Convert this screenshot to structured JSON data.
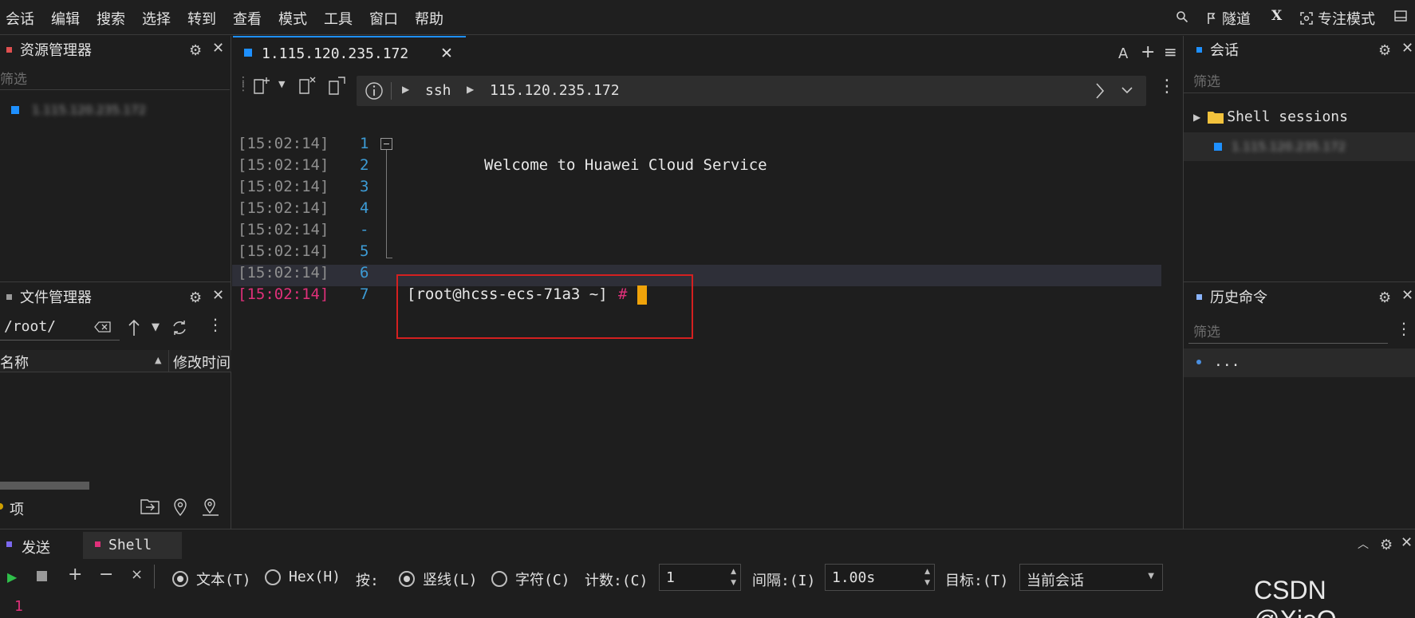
{
  "menu": [
    "会话",
    "编辑",
    "搜索",
    "选择",
    "转到",
    "查看",
    "模式",
    "工具",
    "窗口",
    "帮助"
  ],
  "menu_right": {
    "tunnel": "隧道",
    "x": "X",
    "focus": "专注模式"
  },
  "resource_panel": {
    "title": "资源管理器",
    "filter_placeholder": "筛选",
    "item": "1.115.120.235.172"
  },
  "file_panel": {
    "title": "文件管理器",
    "path": "/root/",
    "col_name": "名称",
    "col_time": "修改时间",
    "footer": "项"
  },
  "tab": {
    "title": "1.115.120.235.172"
  },
  "tab_right": {
    "font": "A",
    "add": "+",
    "menu": "≡"
  },
  "address": {
    "protocol": "ssh",
    "host": "115.120.235.172"
  },
  "terminal": {
    "lines": [
      {
        "ts": "[15:02:14]",
        "num": "1",
        "text": ""
      },
      {
        "ts": "[15:02:14]",
        "num": "2",
        "text": "Welcome to Huawei Cloud Service"
      },
      {
        "ts": "[15:02:14]",
        "num": "3",
        "text": ""
      },
      {
        "ts": "[15:02:14]",
        "num": "4",
        "text": ""
      },
      {
        "ts": "[15:02:14]",
        "num": "-",
        "text": ""
      },
      {
        "ts": "[15:02:14]",
        "num": "5",
        "text": ""
      },
      {
        "ts": "[15:02:14]",
        "num": "6",
        "text": ""
      },
      {
        "ts": "[15:02:14]",
        "num": "7",
        "text": "[root@hcss-ecs-71a3 ~]",
        "prompt_symbol": "#"
      }
    ]
  },
  "sessions_panel": {
    "title": "会话",
    "filter_placeholder": "筛选",
    "folder": "Shell sessions",
    "item": "1.115.120.235.172"
  },
  "history_panel": {
    "title": "历史命令",
    "filter_placeholder": "筛选",
    "item": "..."
  },
  "bottom": {
    "tab_send": "发送",
    "tab_shell": "Shell",
    "opt_text": "文本(T)",
    "opt_hex": "Hex(H)",
    "by_label": "按:",
    "opt_line": "竖线(L)",
    "opt_char": "字符(C)",
    "count_label": "计数:(C)",
    "count_value": "1",
    "interval_label": "间隔:(I)",
    "interval_value": "1.00s",
    "target_label": "目标:(T)",
    "target_value": "当前会话",
    "input_line": "1"
  },
  "watermark": "CSDN @XioQ",
  "colors": {
    "accent_blue": "#1e90ff",
    "prompt_hash": "#e0307a",
    "cursor": "#f0a30a",
    "highlight_box": "#d42020",
    "timestamp_active": "#e0307a",
    "line_number": "#3d9cd6"
  }
}
